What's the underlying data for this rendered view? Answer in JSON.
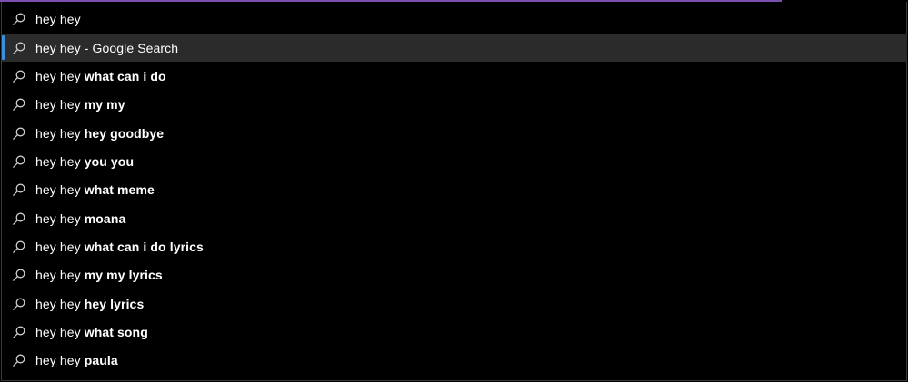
{
  "colors": {
    "accent_bar": "#7b4fb0",
    "selection_bg": "#2b2b2b",
    "selection_marker": "#3c8fdc",
    "text": "#ffffff",
    "background": "#000000"
  },
  "search": {
    "icon": "search-icon",
    "query": "hey hey"
  },
  "suggestions": [
    {
      "icon": "search-icon",
      "prefix": "hey hey",
      "completion": " - Google Search",
      "completion_bold": false,
      "selected": true
    },
    {
      "icon": "search-icon",
      "prefix": "hey hey ",
      "completion": "what can i do",
      "completion_bold": true,
      "selected": false
    },
    {
      "icon": "search-icon",
      "prefix": "hey hey ",
      "completion": "my my",
      "completion_bold": true,
      "selected": false
    },
    {
      "icon": "search-icon",
      "prefix": "hey hey ",
      "completion": "hey goodbye",
      "completion_bold": true,
      "selected": false
    },
    {
      "icon": "search-icon",
      "prefix": "hey hey ",
      "completion": "you you",
      "completion_bold": true,
      "selected": false
    },
    {
      "icon": "search-icon",
      "prefix": "hey hey ",
      "completion": "what meme",
      "completion_bold": true,
      "selected": false
    },
    {
      "icon": "search-icon",
      "prefix": "hey hey ",
      "completion": "moana",
      "completion_bold": true,
      "selected": false
    },
    {
      "icon": "search-icon",
      "prefix": "hey hey ",
      "completion": "what can i do lyrics",
      "completion_bold": true,
      "selected": false
    },
    {
      "icon": "search-icon",
      "prefix": "hey hey ",
      "completion": "my my lyrics",
      "completion_bold": true,
      "selected": false
    },
    {
      "icon": "search-icon",
      "prefix": "hey hey ",
      "completion": "hey lyrics",
      "completion_bold": true,
      "selected": false
    },
    {
      "icon": "search-icon",
      "prefix": "hey hey ",
      "completion": "what song",
      "completion_bold": true,
      "selected": false
    },
    {
      "icon": "search-icon",
      "prefix": "hey hey ",
      "completion": "paula",
      "completion_bold": true,
      "selected": false
    }
  ]
}
